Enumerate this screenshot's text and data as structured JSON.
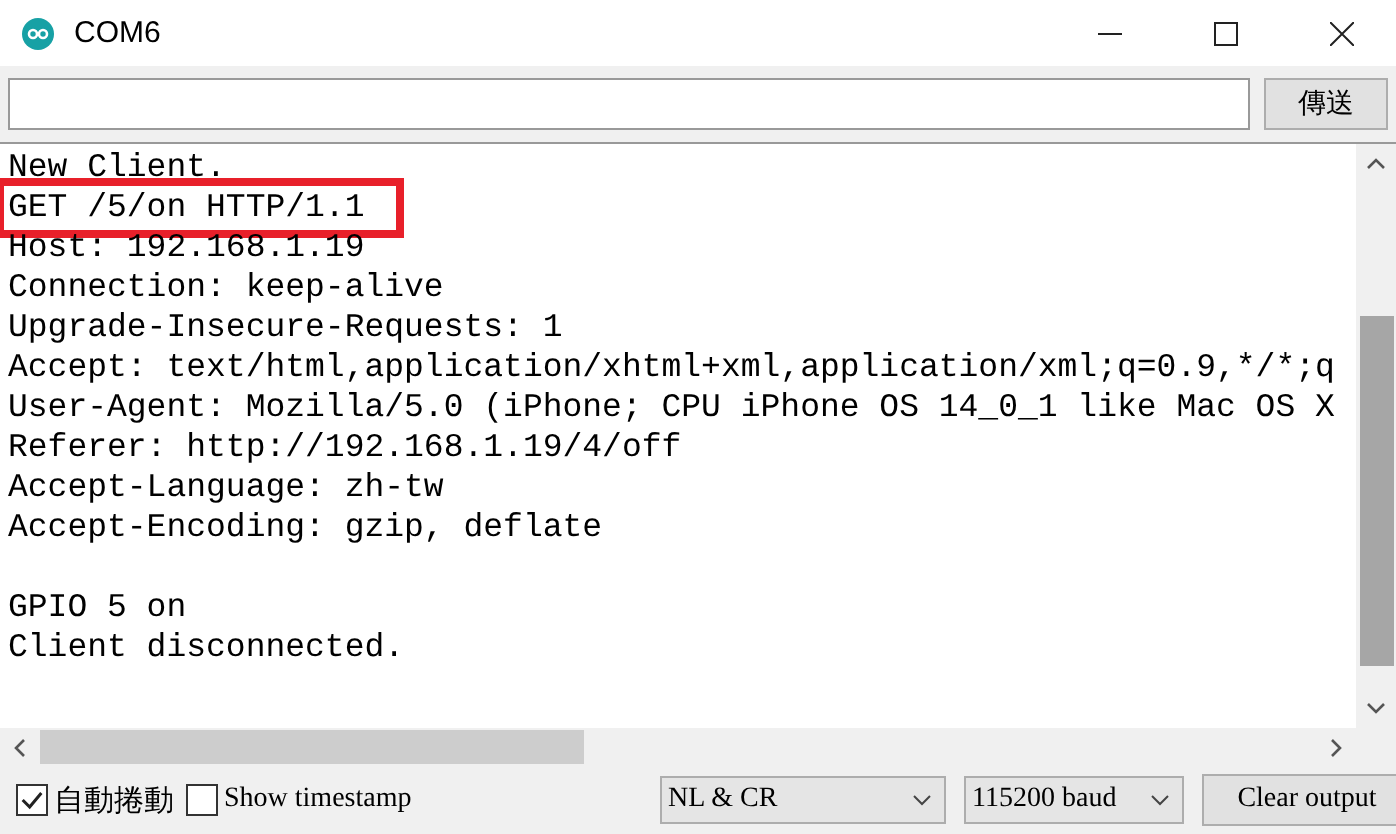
{
  "window": {
    "title": "COM6"
  },
  "send_button": "傳送",
  "output_blocks": [
    {
      "lines": [
        {
          "text": "New Client.",
          "highlighted": false
        },
        {
          "text": "GET /5/on HTTP/1.1",
          "highlighted": true
        },
        {
          "text": "Host: 192.168.1.19",
          "highlighted": false
        },
        {
          "text": "Connection: keep-alive",
          "highlighted": false
        },
        {
          "text": "Upgrade-Insecure-Requests: 1",
          "highlighted": false
        },
        {
          "text": "Accept: text/html,application/xhtml+xml,application/xml;q=0.9,*/*;q",
          "highlighted": false
        },
        {
          "text": "User-Agent: Mozilla/5.0 (iPhone; CPU iPhone OS 14_0_1 like Mac OS X",
          "highlighted": false
        },
        {
          "text": "Referer: http://192.168.1.19/4/off",
          "highlighted": false
        },
        {
          "text": "Accept-Language: zh-tw",
          "highlighted": false
        },
        {
          "text": "Accept-Encoding: gzip, deflate",
          "highlighted": false
        }
      ]
    },
    {
      "lines": [
        {
          "text": "GPIO 5 on",
          "highlighted": false
        },
        {
          "text": "Client disconnected.",
          "highlighted": false
        }
      ]
    }
  ],
  "footer": {
    "autoscroll": {
      "label": "自動捲動",
      "checked": true
    },
    "timestamp": {
      "label": "Show timestamp",
      "checked": false
    },
    "line_ending": "NL & CR",
    "baud": "115200 baud",
    "clear_button": "Clear output"
  }
}
